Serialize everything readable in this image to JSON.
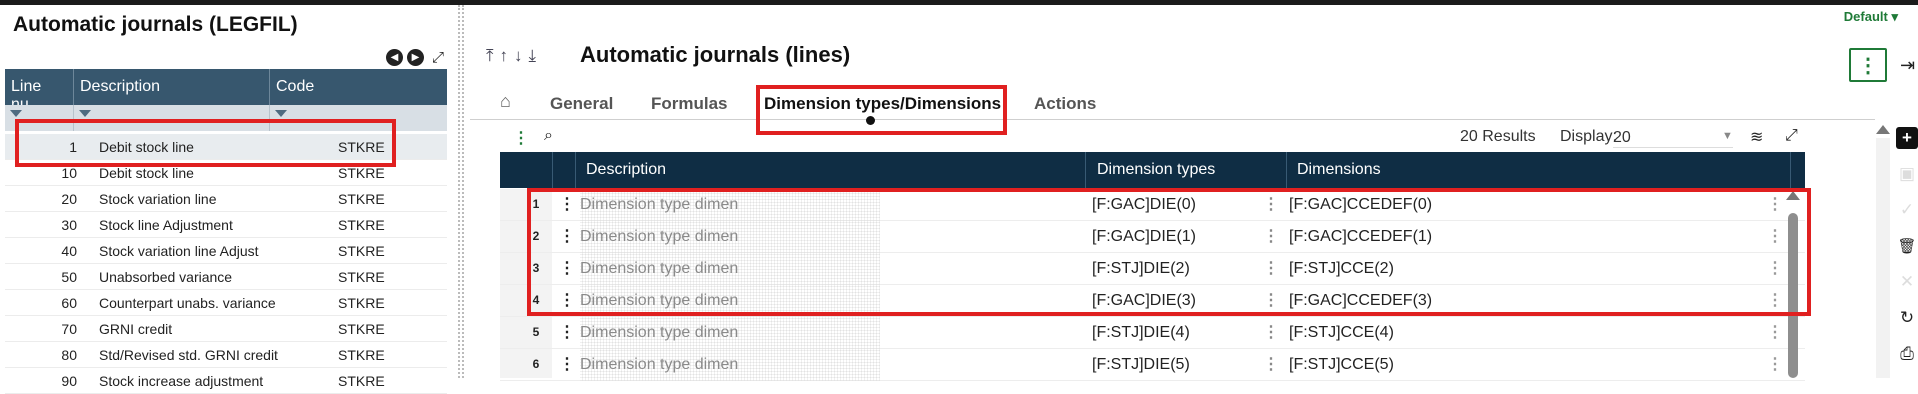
{
  "left": {
    "title": "Automatic journals (LEGFIL)",
    "nav": {
      "prev_icon": "◀",
      "next_icon": "▶",
      "expand_icon": "⤢"
    },
    "columns": [
      "Line nu...",
      "Description",
      "Code"
    ],
    "rows": [
      {
        "line": "1",
        "description": "Debit stock line",
        "code": "STKRE"
      },
      {
        "line": "10",
        "description": "Debit stock line",
        "code": "STKRE"
      },
      {
        "line": "20",
        "description": "Stock variation line",
        "code": "STKRE"
      },
      {
        "line": "30",
        "description": "Stock line Adjustment",
        "code": "STKRE"
      },
      {
        "line": "40",
        "description": "Stock variation line Adjust",
        "code": "STKRE"
      },
      {
        "line": "50",
        "description": "Unabsorbed variance",
        "code": "STKRE"
      },
      {
        "line": "60",
        "description": "Counterpart unabs. variance",
        "code": "STKRE"
      },
      {
        "line": "70",
        "description": "GRNI credit",
        "code": "STKRE"
      },
      {
        "line": "80",
        "description": "Std/Revised std. GRNI credit",
        "code": "STKRE"
      },
      {
        "line": "90",
        "description": "Stock increase adjustment",
        "code": "STKRE"
      }
    ]
  },
  "header": {
    "title": "Automatic journals (lines)",
    "default_label": "Default",
    "default_caret": "▾",
    "arrows": [
      "⤒",
      "↑",
      "↓",
      "⤓"
    ],
    "kebab": "⋮",
    "logout_icon": "⇥"
  },
  "tabs": {
    "home_icon": "⌂",
    "items": [
      {
        "label": "General"
      },
      {
        "label": "Formulas"
      },
      {
        "label": "Dimension types/Dimensions"
      },
      {
        "label": "Actions"
      }
    ],
    "active": "Dimension types/Dimensions"
  },
  "grid": {
    "toolbar": {
      "kebab": "⋮",
      "search_icon": "⌕",
      "results": "20 Results",
      "display_label": "Display:",
      "display_value": "20",
      "caret": "▼",
      "layers_icon": "≋",
      "expand_icon": "⤢"
    },
    "columns": [
      "Description",
      "Dimension types",
      "Dimensions"
    ],
    "row_kebab": "⋮",
    "rows": [
      {
        "num": "1",
        "description": "Dimension type dimen",
        "dimension_type": "[F:GAC]DIE(0)",
        "dimension": "[F:GAC]CCEDEF(0)"
      },
      {
        "num": "2",
        "description": "Dimension type dimen",
        "dimension_type": "[F:GAC]DIE(1)",
        "dimension": "[F:GAC]CCEDEF(1)"
      },
      {
        "num": "3",
        "description": "Dimension type dimen",
        "dimension_type": "[F:STJ]DIE(2)",
        "dimension": "[F:STJ]CCE(2)"
      },
      {
        "num": "4",
        "description": "Dimension type dimen",
        "dimension_type": "[F:GAC]DIE(3)",
        "dimension": "[F:GAC]CCEDEF(3)"
      },
      {
        "num": "5",
        "description": "Dimension type dimen",
        "dimension_type": "[F:STJ]DIE(4)",
        "dimension": "[F:STJ]CCE(4)"
      },
      {
        "num": "6",
        "description": "Dimension type dimen",
        "dimension_type": "[F:STJ]DIE(5)",
        "dimension": "[F:STJ]CCE(5)"
      }
    ]
  },
  "action_bar": {
    "add": "+",
    "save": "▣",
    "validate": "✓",
    "delete": "🗑",
    "cancel": "✕",
    "refresh": "↻",
    "print": "⎙"
  },
  "colors": {
    "highlight": "#e02020",
    "header_dark": "#0f2d44",
    "left_header": "#37576e",
    "brand_green": "#1f7a37"
  }
}
